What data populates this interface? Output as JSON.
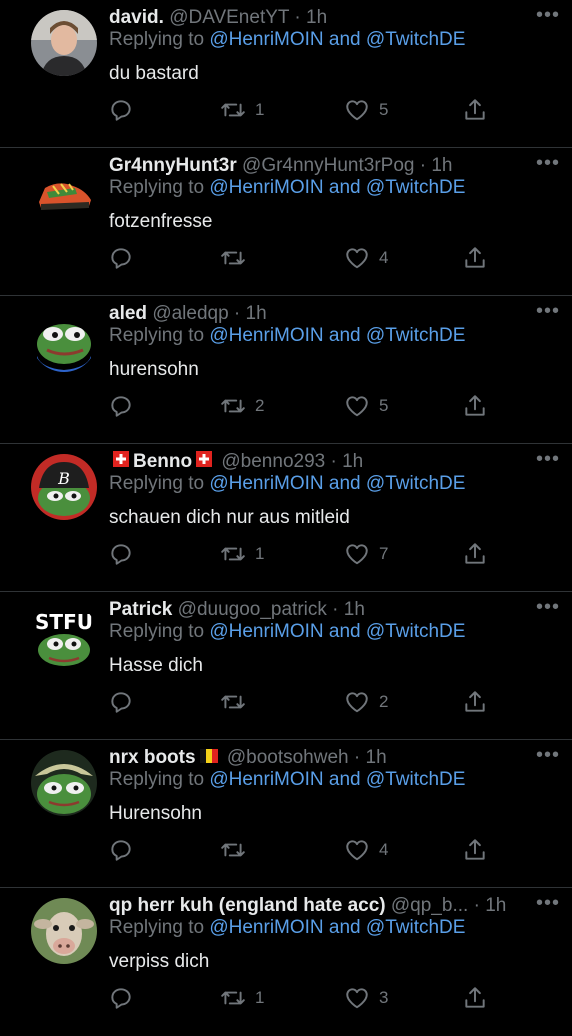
{
  "reply_prefix": "Replying to",
  "reply_and": "and",
  "more_label": "•••",
  "tweets": [
    {
      "name": "david.",
      "handle": "@DAVEnetYT",
      "time": "1h",
      "mention1": "@HenriMOIN",
      "mention2": "@TwitchDE",
      "text": "du bastard",
      "replies": "",
      "retweets": "1",
      "likes": "5"
    },
    {
      "name": "Gr4nnyHunt3r",
      "handle": "@Gr4nnyHunt3rPog",
      "time": "1h",
      "mention1": "@HenriMOIN",
      "mention2": "@TwitchDE",
      "text": "fotzenfresse",
      "replies": "",
      "retweets": "",
      "likes": "4"
    },
    {
      "name": "aled",
      "handle": "@aledqp",
      "time": "1h",
      "mention1": "@HenriMOIN",
      "mention2": "@TwitchDE",
      "text": "hurensohn",
      "replies": "",
      "retweets": "2",
      "likes": "5"
    },
    {
      "name": "Benno",
      "handle": "@benno293",
      "time": "1h",
      "mention1": "@HenriMOIN",
      "mention2": "@TwitchDE",
      "text": "schauen dich nur aus mitleid",
      "replies": "",
      "retweets": "1",
      "likes": "7"
    },
    {
      "name": "Patrick",
      "handle": "@duugoo_patrick",
      "time": "1h",
      "mention1": "@HenriMOIN",
      "mention2": "@TwitchDE",
      "text": "Hasse dich",
      "replies": "",
      "retweets": "",
      "likes": "2"
    },
    {
      "name": "nrx boots",
      "handle": "@bootsohweh",
      "time": "1h",
      "mention1": "@HenriMOIN",
      "mention2": "@TwitchDE",
      "text": "Hurensohn",
      "replies": "",
      "retweets": "",
      "likes": "4"
    },
    {
      "name": "qp herr kuh (england hate acc)",
      "handle": "@qp_b...",
      "time": "1h",
      "mention1": "@HenriMOIN",
      "mention2": "@TwitchDE",
      "text": "verpiss dich",
      "replies": "",
      "retweets": "1",
      "likes": "3"
    }
  ],
  "avatar_text": {
    "benno": "B",
    "patrick": "STFU"
  },
  "colors": {
    "background": "#000000",
    "text": "#e7e9ea",
    "secondary": "#71767b",
    "mention": "#5a9fe8",
    "divider": "#2f3336"
  }
}
